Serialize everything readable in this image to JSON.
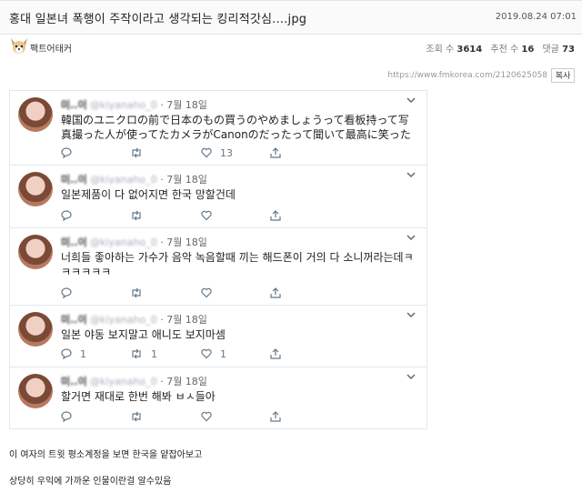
{
  "post": {
    "title": "홍대 일본녀 폭행이 주작이라고 생각되는 킹리적갓심....jpg",
    "date": "2019.08.24 07:01",
    "author": "팩트어태커",
    "views_label": "조회 수",
    "views": "3614",
    "likes_label": "추천 수",
    "likes": "16",
    "comments_label": "댓글",
    "comments": "73",
    "url": "https://www.fmkorea.com/2120625058",
    "copy_label": "복사"
  },
  "tweets": [
    {
      "name": "미..이",
      "handle": "@kiyanaho_0",
      "date": "· 7월 18일",
      "text": "韓国のユニクロの前で日本のもの買うのやめましょうって看板持って写真撮った人が使ってたカメラがCanonのだったって聞いて最高に笑った",
      "reply": "",
      "retweet": "",
      "like": "13"
    },
    {
      "name": "미..이",
      "handle": "@kiyanaho_0",
      "date": "· 7월 18일",
      "text": "일본제품이 다 없어지면 한국 망할건데",
      "reply": "",
      "retweet": "",
      "like": ""
    },
    {
      "name": "미..이",
      "handle": "@kiyanaho_0",
      "date": "· 7월 18일",
      "text": "너희들 좋아하는 가수가 음악 녹음할때 끼는 해드폰이 거의 다 소니꺼라는데ㅋㅋㅋㅋㅋㅋ",
      "reply": "",
      "retweet": "",
      "like": ""
    },
    {
      "name": "미..이",
      "handle": "@kiyanaho_0",
      "date": "· 7월 18일",
      "text": "일본 야동 보지말고 애니도 보지마셈",
      "reply": "1",
      "retweet": "1",
      "like": "1"
    },
    {
      "name": "미..이",
      "handle": "@kiyanaho_0",
      "date": "· 7월 18일",
      "text": "할거면 재대로 한번 해봐 ㅂㅅ들아",
      "reply": "",
      "retweet": "",
      "like": ""
    }
  ],
  "footer": {
    "line1": "이 여자의 트윗 평소계정을 보면 한국을 얕잡아보고",
    "line2": "상당히 우익에 가까운 인물이란걸 알수있음"
  },
  "icons": {
    "reply": "reply-icon",
    "retweet": "retweet-icon",
    "like": "heart-icon",
    "share": "share-icon",
    "menu": "chevron-down-icon"
  }
}
